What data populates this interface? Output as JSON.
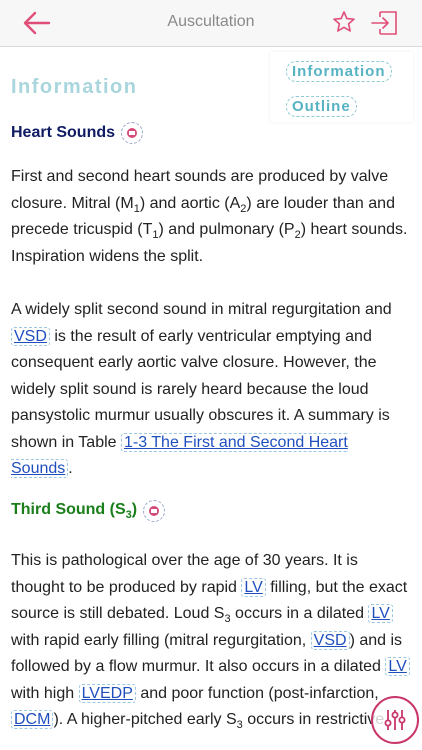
{
  "header": {
    "title": "Auscultation"
  },
  "content": {
    "section_heading": "Information",
    "toc": {
      "items": [
        "Information",
        "Outline"
      ]
    },
    "heart_sounds": {
      "heading": "Heart Sounds"
    },
    "paragraph1": {
      "t1": "First and second heart sounds are produced by valve closure. Mitral (M",
      "s1": "1",
      "t2": ") and aortic (A",
      "s2": "2",
      "t3": ") are louder than and precede tricuspid (T",
      "s3": "1",
      "t4": ") and pulmonary (P",
      "s4": "2",
      "t5": ") heart sounds. Inspiration widens the split."
    },
    "paragraph2": {
      "t1": "A widely split second sound in mitral regurgitation and ",
      "link_vsd": "VSD",
      "t2": " is the result of early ventricular emptying and consequent early aortic valve closure. However, the widely split sound is rarely heard because the loud pansystolic murmur usually obscures it. A summary is shown in Table ",
      "link_table": "1-3 The First and Second Heart Sounds",
      "t3": "."
    },
    "third_sound": {
      "heading_main": "Third Sound (S",
      "heading_sub": "3",
      "heading_end": ")"
    },
    "paragraph3": {
      "t1": "This is pathological over the age of 30 years. It is thought to be produced by rapid ",
      "link_lv1": "LV",
      "t2": " filling, but the exact source is still debated. Loud S",
      "s1": "3",
      "t3": " occurs in a dilated ",
      "link_lv2": "LV",
      "t4": " with rapid early filling (mitral regurgitation, ",
      "link_vsd": "VSD",
      "t5": ") and is followed by a flow murmur. It also occurs in a dilated ",
      "link_lv3": "LV",
      "t6": " with high ",
      "link_lvedp": "LVEDP",
      "t7": " and poor function (post-infarction, ",
      "link_dcm": "DCM",
      "t8": "). A higher-pitched early S",
      "s2": "3",
      "t9": " occurs in restrictive"
    }
  },
  "colors": {
    "accent": "#e04e78",
    "section_heading": "#a9d5dd",
    "heading_sounds": "#0f1b62",
    "heading_third": "#1a7e1a",
    "link": "#1f4fbf"
  },
  "icons": {
    "back": "arrow-left-icon",
    "favorite": "star-icon",
    "exit": "exit-icon",
    "heading_badge": "sound-icon",
    "settings": "sliders-icon"
  }
}
